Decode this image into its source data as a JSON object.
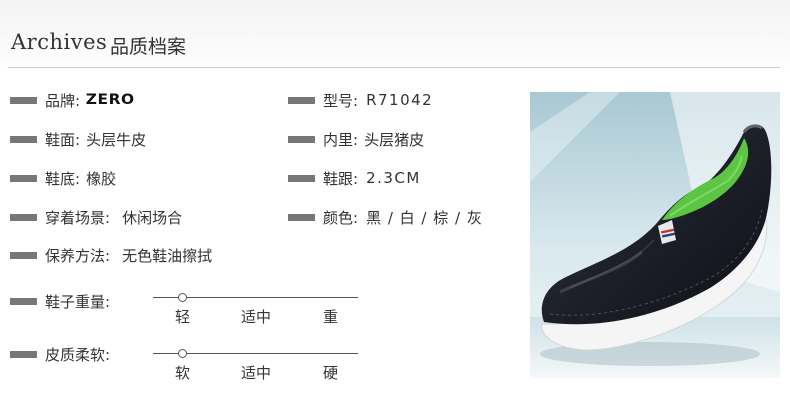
{
  "header": {
    "title_en": "Archives",
    "title_cn": "品质档案"
  },
  "specs": {
    "brand": {
      "label": "品牌:",
      "value": "ZERO"
    },
    "model": {
      "label": "型号:",
      "value": "R71042"
    },
    "upper": {
      "label": "鞋面:",
      "value": "头层牛皮"
    },
    "lining": {
      "label": "内里:",
      "value": "头层猪皮"
    },
    "sole": {
      "label": "鞋底:",
      "value": "橡胶"
    },
    "heel": {
      "label": "鞋跟:",
      "value": "2.3CM"
    },
    "occasion": {
      "label": "穿着场景:",
      "value": "休闲场合"
    },
    "color": {
      "label": "颜色:",
      "value": "黑 / 白 / 棕 / 灰"
    },
    "care": {
      "label": "保养方法:",
      "value": "无色鞋油擦拭"
    }
  },
  "scales": {
    "weight": {
      "label": "鞋子重量:",
      "ticks": [
        "轻",
        "适中",
        "重"
      ],
      "level": 0.14
    },
    "softness": {
      "label": "皮质柔软:",
      "ticks": [
        "软",
        "适中",
        "硬"
      ],
      "level": 0.14
    }
  },
  "colors": {
    "bar": "#777777",
    "shoe": "#1d2029",
    "insole": "#5cc542",
    "backdrop": "#b9d6de"
  }
}
